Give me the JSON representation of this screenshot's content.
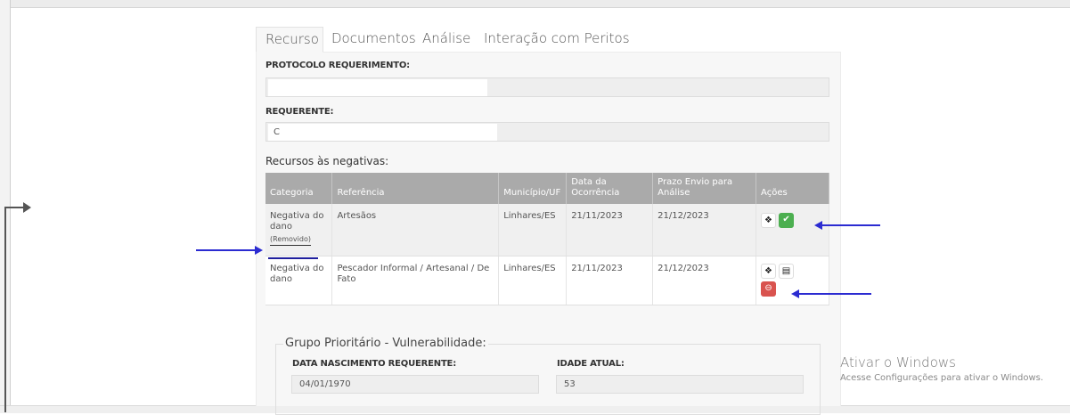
{
  "tabs": [
    {
      "label": "Recurso"
    },
    {
      "label": "Documentos"
    },
    {
      "label": "Análise"
    },
    {
      "label": "Interação com Peritos"
    }
  ],
  "form": {
    "protocolo_label": "PROTOCOLO REQUERIMENTO:",
    "requerente_label": "REQUERENTE:",
    "requerente_value": "C"
  },
  "recursos": {
    "title": "Recursos às negativas:",
    "headers": [
      "Categoria",
      "Referência",
      "Município/UF",
      "Data da Ocorrência",
      "Prazo Envio para Análise",
      "Ações"
    ],
    "rows": [
      {
        "categoria": "Negativa do dano",
        "status": "(Removido)",
        "referencia": "Artesãos",
        "municipio": "Linhares/ES",
        "data": "21/11/2023",
        "prazo": "21/12/2023"
      },
      {
        "categoria": "Negativa do dano",
        "status": "",
        "referencia": "Pescador Informal / Artesanal / De Fato",
        "municipio": "Linhares/ES",
        "data": "21/11/2023",
        "prazo": "21/12/2023"
      }
    ]
  },
  "grupo": {
    "legend": "Grupo Prioritário - Vulnerabilidade:",
    "nascimento_label": "DATA NASCIMENTO REQUERENTE:",
    "nascimento_value": "04/01/1970",
    "idade_label": "IDADE ATUAL:",
    "idade_value": "53"
  },
  "windows": {
    "title": "Ativar o Windows",
    "subtitle": "Acesse Configurações para ativar o Windows."
  },
  "colors": {
    "header_bg": "#aaaaaa",
    "accept_green": "#4caf50",
    "remove_red": "#d9534f",
    "annotation_blue": "#2b2bd1"
  },
  "icons": [
    "info-icon",
    "check-icon",
    "folder-open-icon",
    "minus-circle-icon",
    "annotation-arrow"
  ]
}
